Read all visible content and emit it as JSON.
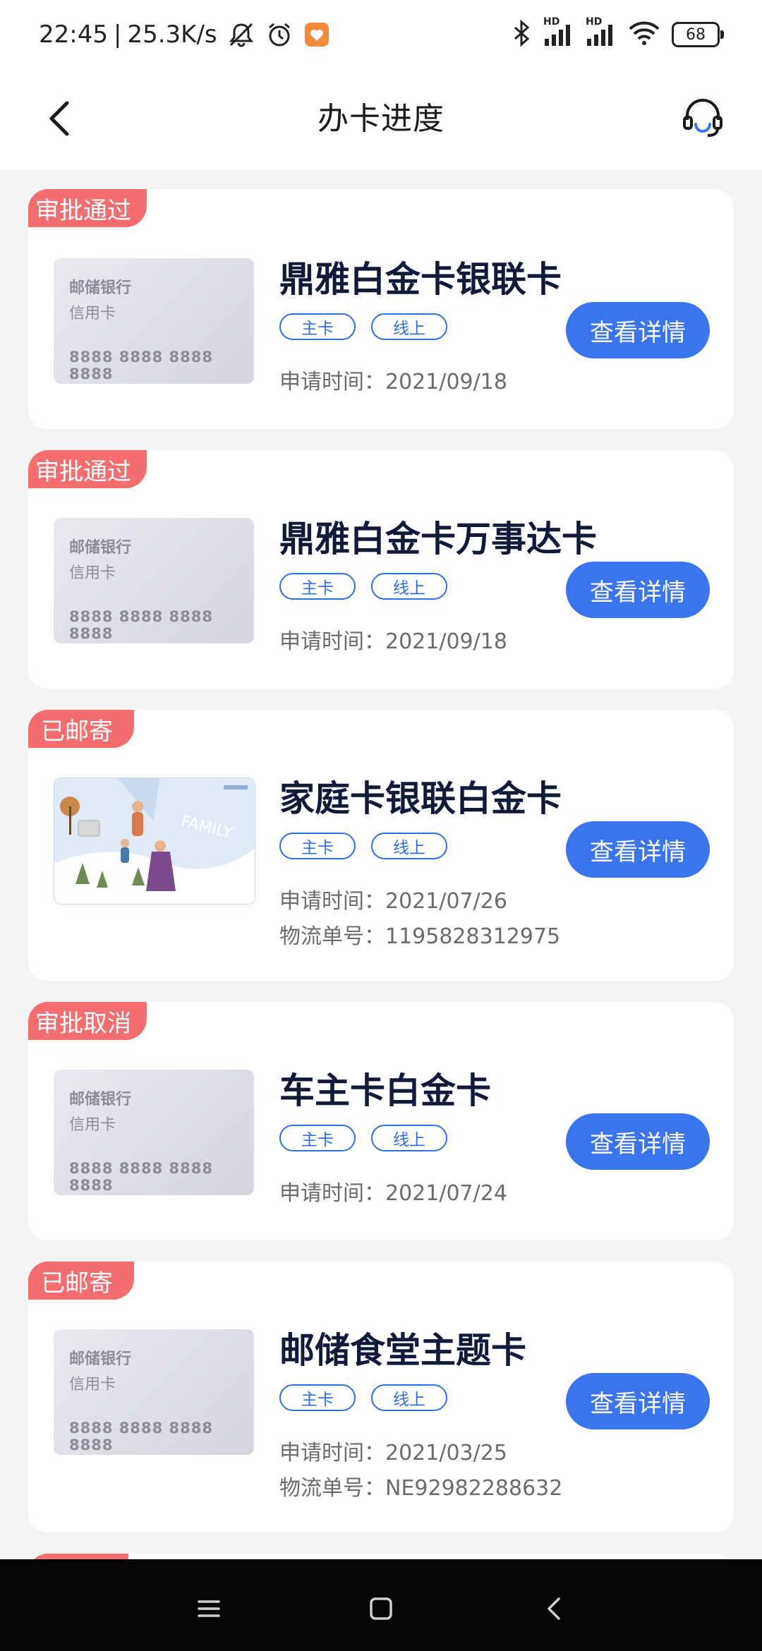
{
  "status_bar": {
    "time": "22:45",
    "separator": "|",
    "net_speed": "25.3K/s",
    "battery": "68",
    "signal_1_label": "HD",
    "signal_2_label": "HD",
    "icons": [
      "mute-icon",
      "alarm-icon",
      "app-notification-icon",
      "bluetooth-icon",
      "signal-icon",
      "wifi-icon",
      "battery-icon"
    ]
  },
  "header": {
    "title": "办卡进度",
    "back_icon": "chevron-left-icon",
    "service_icon": "customer-service-icon"
  },
  "placeholder_card": {
    "bank": "邮储银行",
    "type": "信用卡",
    "number": "8888 8888 8888 8888"
  },
  "cards": [
    {
      "status": "审批通过",
      "name": "鼎雅白金卡银联卡",
      "tags": [
        "主卡",
        "线上"
      ],
      "apply_label": "申请时间：",
      "apply_date": "2021/09/18",
      "button": "查看详情"
    },
    {
      "status": "审批通过",
      "name": "鼎雅白金卡万事达卡",
      "tags": [
        "主卡",
        "线上"
      ],
      "apply_label": "申请时间：",
      "apply_date": "2021/09/18",
      "button": "查看详情"
    },
    {
      "status": "已邮寄",
      "name": "家庭卡银联白金卡",
      "tags": [
        "主卡",
        "线上"
      ],
      "apply_label": "申请时间：",
      "apply_date": "2021/07/26",
      "logistics_label": "物流单号：",
      "logistics_no": "1195828312975",
      "button": "查看详情",
      "card_art_text": "FAMILY"
    },
    {
      "status": "审批取消",
      "name": "车主卡白金卡",
      "tags": [
        "主卡",
        "线上"
      ],
      "apply_label": "申请时间：",
      "apply_date": "2021/07/24",
      "button": "查看详情"
    },
    {
      "status": "已邮寄",
      "name": "邮储食堂主题卡",
      "tags": [
        "主卡",
        "线上"
      ],
      "apply_label": "申请时间：",
      "apply_date": "2021/03/25",
      "logistics_label": "物流单号：",
      "logistics_no": "NE92982288632",
      "button": "查看详情"
    }
  ],
  "colors": {
    "accent": "#3a74ee",
    "badge": "#f46e6e",
    "title_text": "#121a3a",
    "background": "#f4f4f6"
  },
  "nav_bar": {
    "icons": [
      "menu-icon",
      "home-icon",
      "back-icon"
    ]
  }
}
